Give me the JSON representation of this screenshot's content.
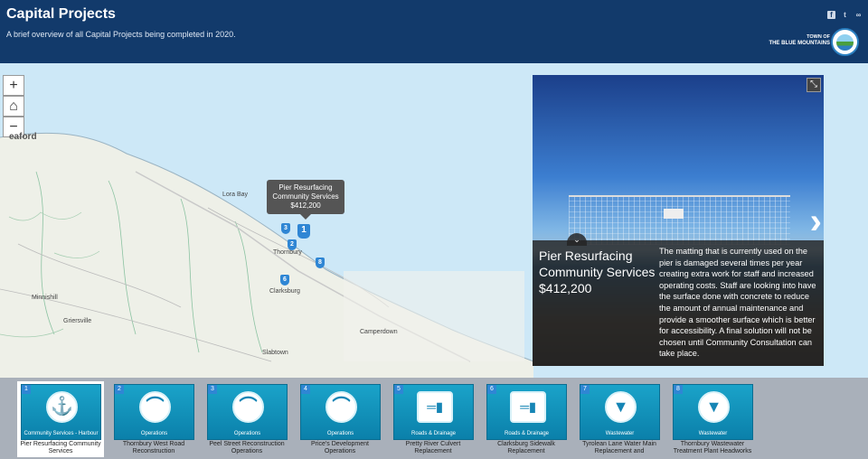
{
  "header": {
    "title": "Capital Projects",
    "subtitle": "A brief overview of all Capital Projects being completed in 2020.",
    "logo_line1": "TOWN OF",
    "logo_line2": "THE BLUE MOUNTAINS",
    "share_icons": [
      "facebook-icon",
      "twitter-icon",
      "link-icon"
    ]
  },
  "map": {
    "controls": {
      "zoom_in": "+",
      "home": "⌂",
      "zoom_out": "−"
    },
    "labels": {
      "meaford": "eaford",
      "lora_bay": "Lora Bay",
      "thornbury": "Thornbury",
      "clarksburg": "Clarksburg",
      "griersville": "Griersville",
      "slabtown": "Slabtown",
      "camperdown": "Camperdown",
      "minnishill": "Minnishill"
    },
    "tooltip": {
      "title": "Pier Resurfacing Community Services",
      "price": "$412,200"
    },
    "pins": [
      "3",
      "1",
      "2",
      "8",
      "6"
    ]
  },
  "popup": {
    "title": "Pier Resurfacing Community Services",
    "price": "$412,200",
    "description": "The matting that is currently used on the pier is damaged several times per year creating extra work for staff and increased operating costs. Staff are looking into have the surface done with concrete to reduce the amount of annual maintenance and provide a smoother surface which is better for accessibility. A final solution will not be chosen until Community Consultation can take place.",
    "expand_icon": "⤡",
    "next_icon": "›",
    "collapse_icon": "⌄"
  },
  "cards": [
    {
      "num": "1",
      "category": "Community Services - Harbour",
      "caption": "Pier Resurfacing Community Services",
      "icon": "anchor-icon"
    },
    {
      "num": "2",
      "category": "Operations",
      "caption": "Thornbury West Road Reconstruction",
      "icon": "bridge-icon"
    },
    {
      "num": "3",
      "category": "Operations",
      "caption": "Peel Street Reconstruction Operations",
      "icon": "bridge-icon"
    },
    {
      "num": "4",
      "category": "Operations",
      "caption": "Price's Development Operations",
      "icon": "bridge-icon"
    },
    {
      "num": "5",
      "category": "Roads & Drainage",
      "caption": "Pretty River Culvert Replacement",
      "icon": "road-icon"
    },
    {
      "num": "6",
      "category": "Roads & Drainage",
      "caption": "Clarksburg Sidewalk Replacement",
      "icon": "road-icon"
    },
    {
      "num": "7",
      "category": "Wastewater",
      "caption": "Tyrolean Lane Water Main Replacement and",
      "icon": "water-drop-icon"
    },
    {
      "num": "8",
      "category": "Wastewater",
      "caption": "Thornbury Wastewater Treatment Plant Headworks",
      "icon": "water-drop-icon"
    }
  ]
}
